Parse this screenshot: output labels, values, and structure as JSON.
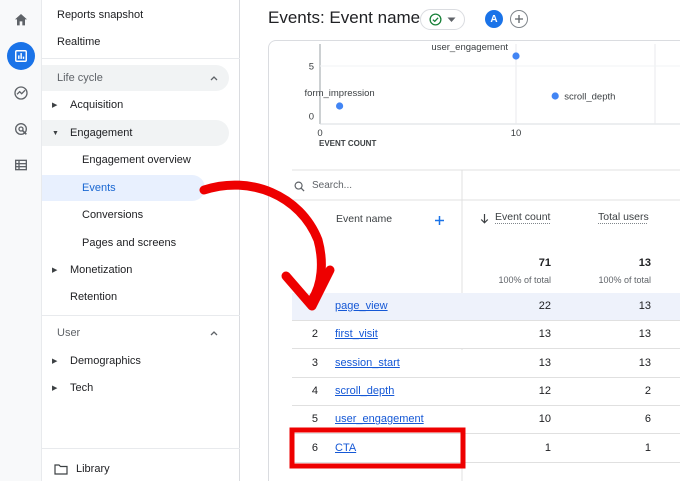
{
  "rail": {
    "icons": [
      "home-icon",
      "reports-icon",
      "explore-icon",
      "advertising-icon",
      "configure-icon"
    ]
  },
  "nav": {
    "reports_snapshot": "Reports snapshot",
    "realtime": "Realtime",
    "lifecycle_section": "Life cycle",
    "acquisition": "Acquisition",
    "engagement": "Engagement",
    "engagement_overview": "Engagement overview",
    "events": "Events",
    "conversions": "Conversions",
    "pages_and_screens": "Pages and screens",
    "monetization": "Monetization",
    "retention": "Retention",
    "user_section": "User",
    "demographics": "Demographics",
    "tech": "Tech",
    "library": "Library"
  },
  "header": {
    "title": "Events: Event name",
    "avatar_letter": "A"
  },
  "chart_data": {
    "type": "scatter",
    "xlabel": "EVENT COUNT",
    "x_ticks": [
      "0",
      "10"
    ],
    "y_ticks": [
      "5",
      "0"
    ],
    "points": [
      {
        "name": "user_engagement",
        "x": 10,
        "y": 6
      },
      {
        "name": "form_impression",
        "x": 1,
        "y": 1
      },
      {
        "name": "scroll_depth",
        "x": 12,
        "y": 2
      }
    ]
  },
  "table": {
    "search_placeholder": "Search...",
    "col_event_name": "Event name",
    "col_event_count": "Event count",
    "col_total_users": "Total users",
    "totals": {
      "event_count": "71",
      "event_count_pct": "100% of total",
      "total_users": "13",
      "total_users_pct": "100% of total"
    },
    "rows": [
      {
        "idx": "",
        "name": "page_view",
        "count": "22",
        "users": "13"
      },
      {
        "idx": "2",
        "name": "first_visit",
        "count": "13",
        "users": "13"
      },
      {
        "idx": "3",
        "name": "session_start",
        "count": "13",
        "users": "13"
      },
      {
        "idx": "4",
        "name": "scroll_depth",
        "count": "12",
        "users": "2"
      },
      {
        "idx": "5",
        "name": "user_engagement",
        "count": "10",
        "users": "6"
      },
      {
        "idx": "6",
        "name": "CTA",
        "count": "1",
        "users": "1"
      }
    ]
  },
  "colors": {
    "accent": "#1a73e8",
    "annotation_red": "#ee0000",
    "selected_nav_bg": "#e8f0fe"
  }
}
